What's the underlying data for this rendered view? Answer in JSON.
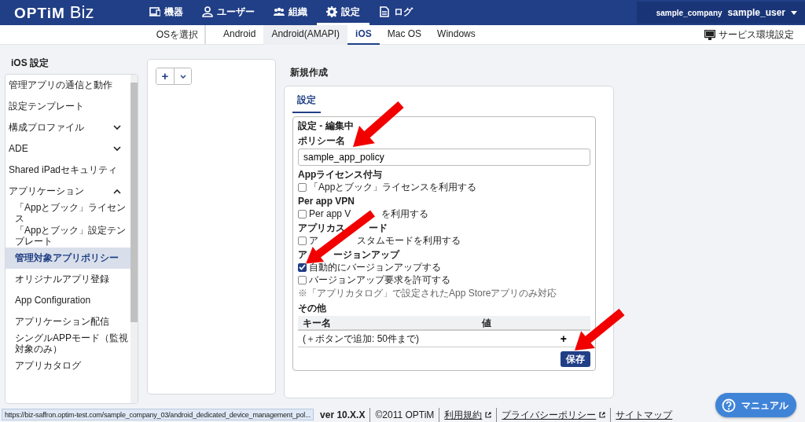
{
  "header": {
    "logo_brand": "OPTiM",
    "logo_product": "Biz",
    "nav": [
      {
        "label": "機器",
        "kind": "device",
        "selected": false
      },
      {
        "label": "ユーザー",
        "kind": "user",
        "selected": false
      },
      {
        "label": "組織",
        "kind": "group",
        "selected": false
      },
      {
        "label": "設定",
        "kind": "settings",
        "selected": true
      },
      {
        "label": "ログ",
        "kind": "log",
        "selected": false
      }
    ],
    "company": "sample_company",
    "user": "sample_user"
  },
  "os_bar": {
    "label": "OSを選択",
    "tabs": [
      {
        "label": "Android",
        "selected": false,
        "hovered": false
      },
      {
        "label": "Android(AMAPI)",
        "selected": false,
        "hovered": true
      },
      {
        "label": "iOS",
        "selected": true,
        "hovered": false
      },
      {
        "label": "Mac OS",
        "selected": false,
        "hovered": false
      },
      {
        "label": "Windows",
        "selected": false,
        "hovered": false
      }
    ],
    "service_settings": "サービス環境設定"
  },
  "sidebar": {
    "title": "iOS 設定",
    "items": [
      {
        "kind": "link",
        "label": "管理アプリの通信と動作",
        "selected": false
      },
      {
        "kind": "link",
        "label": "設定テンプレート",
        "selected": false
      },
      {
        "kind": "group",
        "label": "構成プロファイル",
        "selected": false,
        "expanded": false
      },
      {
        "kind": "group",
        "label": "ADE",
        "selected": false,
        "expanded": false
      },
      {
        "kind": "link",
        "label": "Shared iPadセキュリティ",
        "selected": false
      },
      {
        "kind": "group",
        "label": "アプリケーション",
        "selected": false,
        "expanded": true,
        "children": [
          {
            "label": "「Appとブック」ライセンス",
            "selected": false
          },
          {
            "label": "「Appとブック」設定テンプレート",
            "selected": false
          },
          {
            "label": "管理対象アプリポリシー",
            "selected": true
          },
          {
            "label": "オリジナルアプリ登録",
            "selected": false
          },
          {
            "label": "App Configuration",
            "selected": false
          },
          {
            "label": "アプリケーション配信",
            "selected": false
          },
          {
            "label": "シングルAPPモード（監視対象のみ）",
            "selected": false
          },
          {
            "label": "アプリカタログ",
            "selected": false
          }
        ]
      }
    ]
  },
  "policy_list": {
    "add_button": "+"
  },
  "editor": {
    "title": "新規作成",
    "tabs": [
      {
        "label": "設定",
        "selected": true
      }
    ],
    "section_title": "設定 - 編集中",
    "fields": [
      {
        "kind": "text",
        "label": [
          "ポリシー名"
        ],
        "value": "sample_app_policy"
      },
      {
        "kind": "checkboxes",
        "label": [
          "Appライセンス付与"
        ],
        "options": [
          {
            "label": [
              "「Appとブック」ライセンスを利用する"
            ],
            "checked": false
          }
        ]
      },
      {
        "kind": "checkboxes",
        "label": [
          "Per app VPN"
        ],
        "options": [
          {
            "label": [
              "Per app V",
              "を利用する"
            ],
            "checked": false
          }
        ]
      },
      {
        "kind": "checkboxes",
        "label": [
          "アプリカス",
          "ード"
        ],
        "options": [
          {
            "label": [
              "ア",
              "スタムモードを利用する"
            ],
            "checked": false
          }
        ]
      },
      {
        "kind": "checkboxes",
        "label": [
          "ア",
          "ージョンアップ"
        ],
        "options": [
          {
            "label": [
              "自動的にバージョンアップする"
            ],
            "checked": true
          },
          {
            "label": [
              "バージョンアップ要求を許可する"
            ],
            "checked": false
          }
        ],
        "note": "※「アプリカタログ」で設定されたApp Storeアプリのみ対応"
      },
      {
        "kind": "table",
        "label": [
          "その他"
        ],
        "columns": [
          "キー名",
          "値"
        ],
        "empty_text": "(＋ボタンで追加: 50件まで)",
        "add_button": "+"
      }
    ],
    "save_button": "保存"
  },
  "footer": {
    "version": "ver 10.X.X",
    "copyright": "©2011 OPTiM",
    "links": [
      {
        "label": "利用規約",
        "external": true
      },
      {
        "label": "プライバシーポリシー",
        "external": true
      },
      {
        "label": "サイトマップ",
        "external": false
      }
    ]
  },
  "status_url": "https://biz-saffron.optim-test.com/sample_company_03/android_dedicated_device_management_pol...",
  "manual_button": "マニュアル"
}
